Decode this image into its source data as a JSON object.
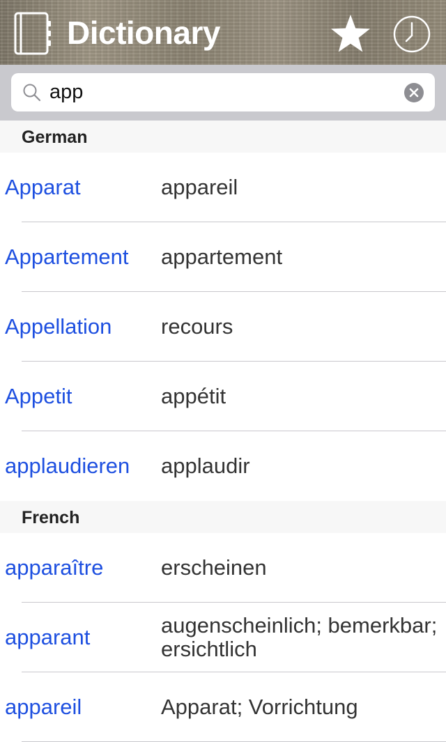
{
  "header": {
    "title": "Dictionary",
    "icons": {
      "left": "book-icon",
      "favorites": "star-icon",
      "history": "clock-icon"
    }
  },
  "search": {
    "value": "app",
    "placeholder": ""
  },
  "sections": [
    {
      "title": "German",
      "rows": [
        {
          "word": "Apparat",
          "translation": "appareil"
        },
        {
          "word": "Appartement",
          "translation": "appartement"
        },
        {
          "word": "Appellation",
          "translation": "recours"
        },
        {
          "word": "Appetit",
          "translation": "appétit"
        },
        {
          "word": "applaudieren",
          "translation": "applaudir"
        }
      ]
    },
    {
      "title": "French",
      "rows": [
        {
          "word": "apparaître",
          "translation": "erscheinen"
        },
        {
          "word": "apparant",
          "translation": "augenscheinlich; bemerkbar; ersichtlich"
        },
        {
          "word": "appareil",
          "translation": "Apparat; Vorrichtung"
        }
      ]
    }
  ],
  "colors": {
    "word": "#1d4fe0",
    "translation": "#333333",
    "section_bg": "#f7f7f7",
    "search_bar_bg": "#c9c9ce"
  }
}
